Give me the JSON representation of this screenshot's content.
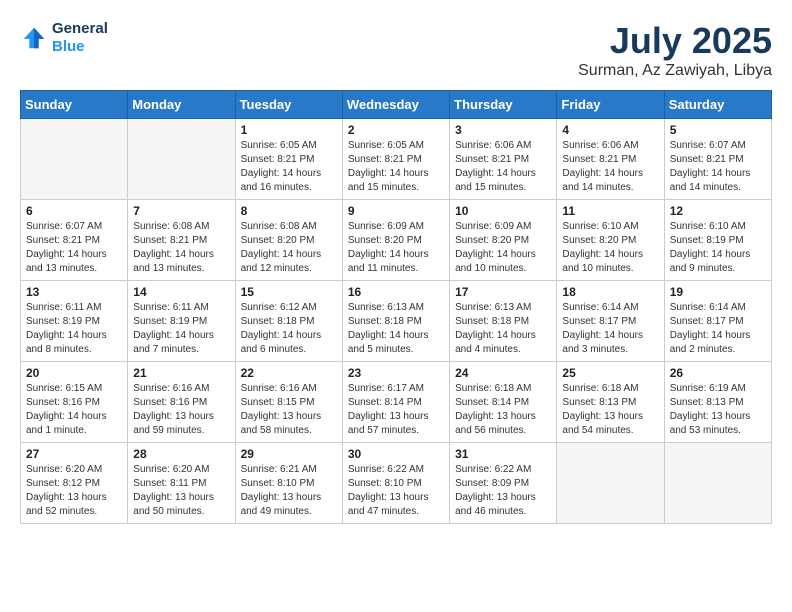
{
  "header": {
    "logo_line1": "General",
    "logo_line2": "Blue",
    "month_title": "July 2025",
    "location": "Surman, Az Zawiyah, Libya"
  },
  "weekdays": [
    "Sunday",
    "Monday",
    "Tuesday",
    "Wednesday",
    "Thursday",
    "Friday",
    "Saturday"
  ],
  "weeks": [
    [
      {
        "day": "",
        "info": ""
      },
      {
        "day": "",
        "info": ""
      },
      {
        "day": "1",
        "info": "Sunrise: 6:05 AM\nSunset: 8:21 PM\nDaylight: 14 hours and 16 minutes."
      },
      {
        "day": "2",
        "info": "Sunrise: 6:05 AM\nSunset: 8:21 PM\nDaylight: 14 hours and 15 minutes."
      },
      {
        "day": "3",
        "info": "Sunrise: 6:06 AM\nSunset: 8:21 PM\nDaylight: 14 hours and 15 minutes."
      },
      {
        "day": "4",
        "info": "Sunrise: 6:06 AM\nSunset: 8:21 PM\nDaylight: 14 hours and 14 minutes."
      },
      {
        "day": "5",
        "info": "Sunrise: 6:07 AM\nSunset: 8:21 PM\nDaylight: 14 hours and 14 minutes."
      }
    ],
    [
      {
        "day": "6",
        "info": "Sunrise: 6:07 AM\nSunset: 8:21 PM\nDaylight: 14 hours and 13 minutes."
      },
      {
        "day": "7",
        "info": "Sunrise: 6:08 AM\nSunset: 8:21 PM\nDaylight: 14 hours and 13 minutes."
      },
      {
        "day": "8",
        "info": "Sunrise: 6:08 AM\nSunset: 8:20 PM\nDaylight: 14 hours and 12 minutes."
      },
      {
        "day": "9",
        "info": "Sunrise: 6:09 AM\nSunset: 8:20 PM\nDaylight: 14 hours and 11 minutes."
      },
      {
        "day": "10",
        "info": "Sunrise: 6:09 AM\nSunset: 8:20 PM\nDaylight: 14 hours and 10 minutes."
      },
      {
        "day": "11",
        "info": "Sunrise: 6:10 AM\nSunset: 8:20 PM\nDaylight: 14 hours and 10 minutes."
      },
      {
        "day": "12",
        "info": "Sunrise: 6:10 AM\nSunset: 8:19 PM\nDaylight: 14 hours and 9 minutes."
      }
    ],
    [
      {
        "day": "13",
        "info": "Sunrise: 6:11 AM\nSunset: 8:19 PM\nDaylight: 14 hours and 8 minutes."
      },
      {
        "day": "14",
        "info": "Sunrise: 6:11 AM\nSunset: 8:19 PM\nDaylight: 14 hours and 7 minutes."
      },
      {
        "day": "15",
        "info": "Sunrise: 6:12 AM\nSunset: 8:18 PM\nDaylight: 14 hours and 6 minutes."
      },
      {
        "day": "16",
        "info": "Sunrise: 6:13 AM\nSunset: 8:18 PM\nDaylight: 14 hours and 5 minutes."
      },
      {
        "day": "17",
        "info": "Sunrise: 6:13 AM\nSunset: 8:18 PM\nDaylight: 14 hours and 4 minutes."
      },
      {
        "day": "18",
        "info": "Sunrise: 6:14 AM\nSunset: 8:17 PM\nDaylight: 14 hours and 3 minutes."
      },
      {
        "day": "19",
        "info": "Sunrise: 6:14 AM\nSunset: 8:17 PM\nDaylight: 14 hours and 2 minutes."
      }
    ],
    [
      {
        "day": "20",
        "info": "Sunrise: 6:15 AM\nSunset: 8:16 PM\nDaylight: 14 hours and 1 minute."
      },
      {
        "day": "21",
        "info": "Sunrise: 6:16 AM\nSunset: 8:16 PM\nDaylight: 13 hours and 59 minutes."
      },
      {
        "day": "22",
        "info": "Sunrise: 6:16 AM\nSunset: 8:15 PM\nDaylight: 13 hours and 58 minutes."
      },
      {
        "day": "23",
        "info": "Sunrise: 6:17 AM\nSunset: 8:14 PM\nDaylight: 13 hours and 57 minutes."
      },
      {
        "day": "24",
        "info": "Sunrise: 6:18 AM\nSunset: 8:14 PM\nDaylight: 13 hours and 56 minutes."
      },
      {
        "day": "25",
        "info": "Sunrise: 6:18 AM\nSunset: 8:13 PM\nDaylight: 13 hours and 54 minutes."
      },
      {
        "day": "26",
        "info": "Sunrise: 6:19 AM\nSunset: 8:13 PM\nDaylight: 13 hours and 53 minutes."
      }
    ],
    [
      {
        "day": "27",
        "info": "Sunrise: 6:20 AM\nSunset: 8:12 PM\nDaylight: 13 hours and 52 minutes."
      },
      {
        "day": "28",
        "info": "Sunrise: 6:20 AM\nSunset: 8:11 PM\nDaylight: 13 hours and 50 minutes."
      },
      {
        "day": "29",
        "info": "Sunrise: 6:21 AM\nSunset: 8:10 PM\nDaylight: 13 hours and 49 minutes."
      },
      {
        "day": "30",
        "info": "Sunrise: 6:22 AM\nSunset: 8:10 PM\nDaylight: 13 hours and 47 minutes."
      },
      {
        "day": "31",
        "info": "Sunrise: 6:22 AM\nSunset: 8:09 PM\nDaylight: 13 hours and 46 minutes."
      },
      {
        "day": "",
        "info": ""
      },
      {
        "day": "",
        "info": ""
      }
    ]
  ]
}
